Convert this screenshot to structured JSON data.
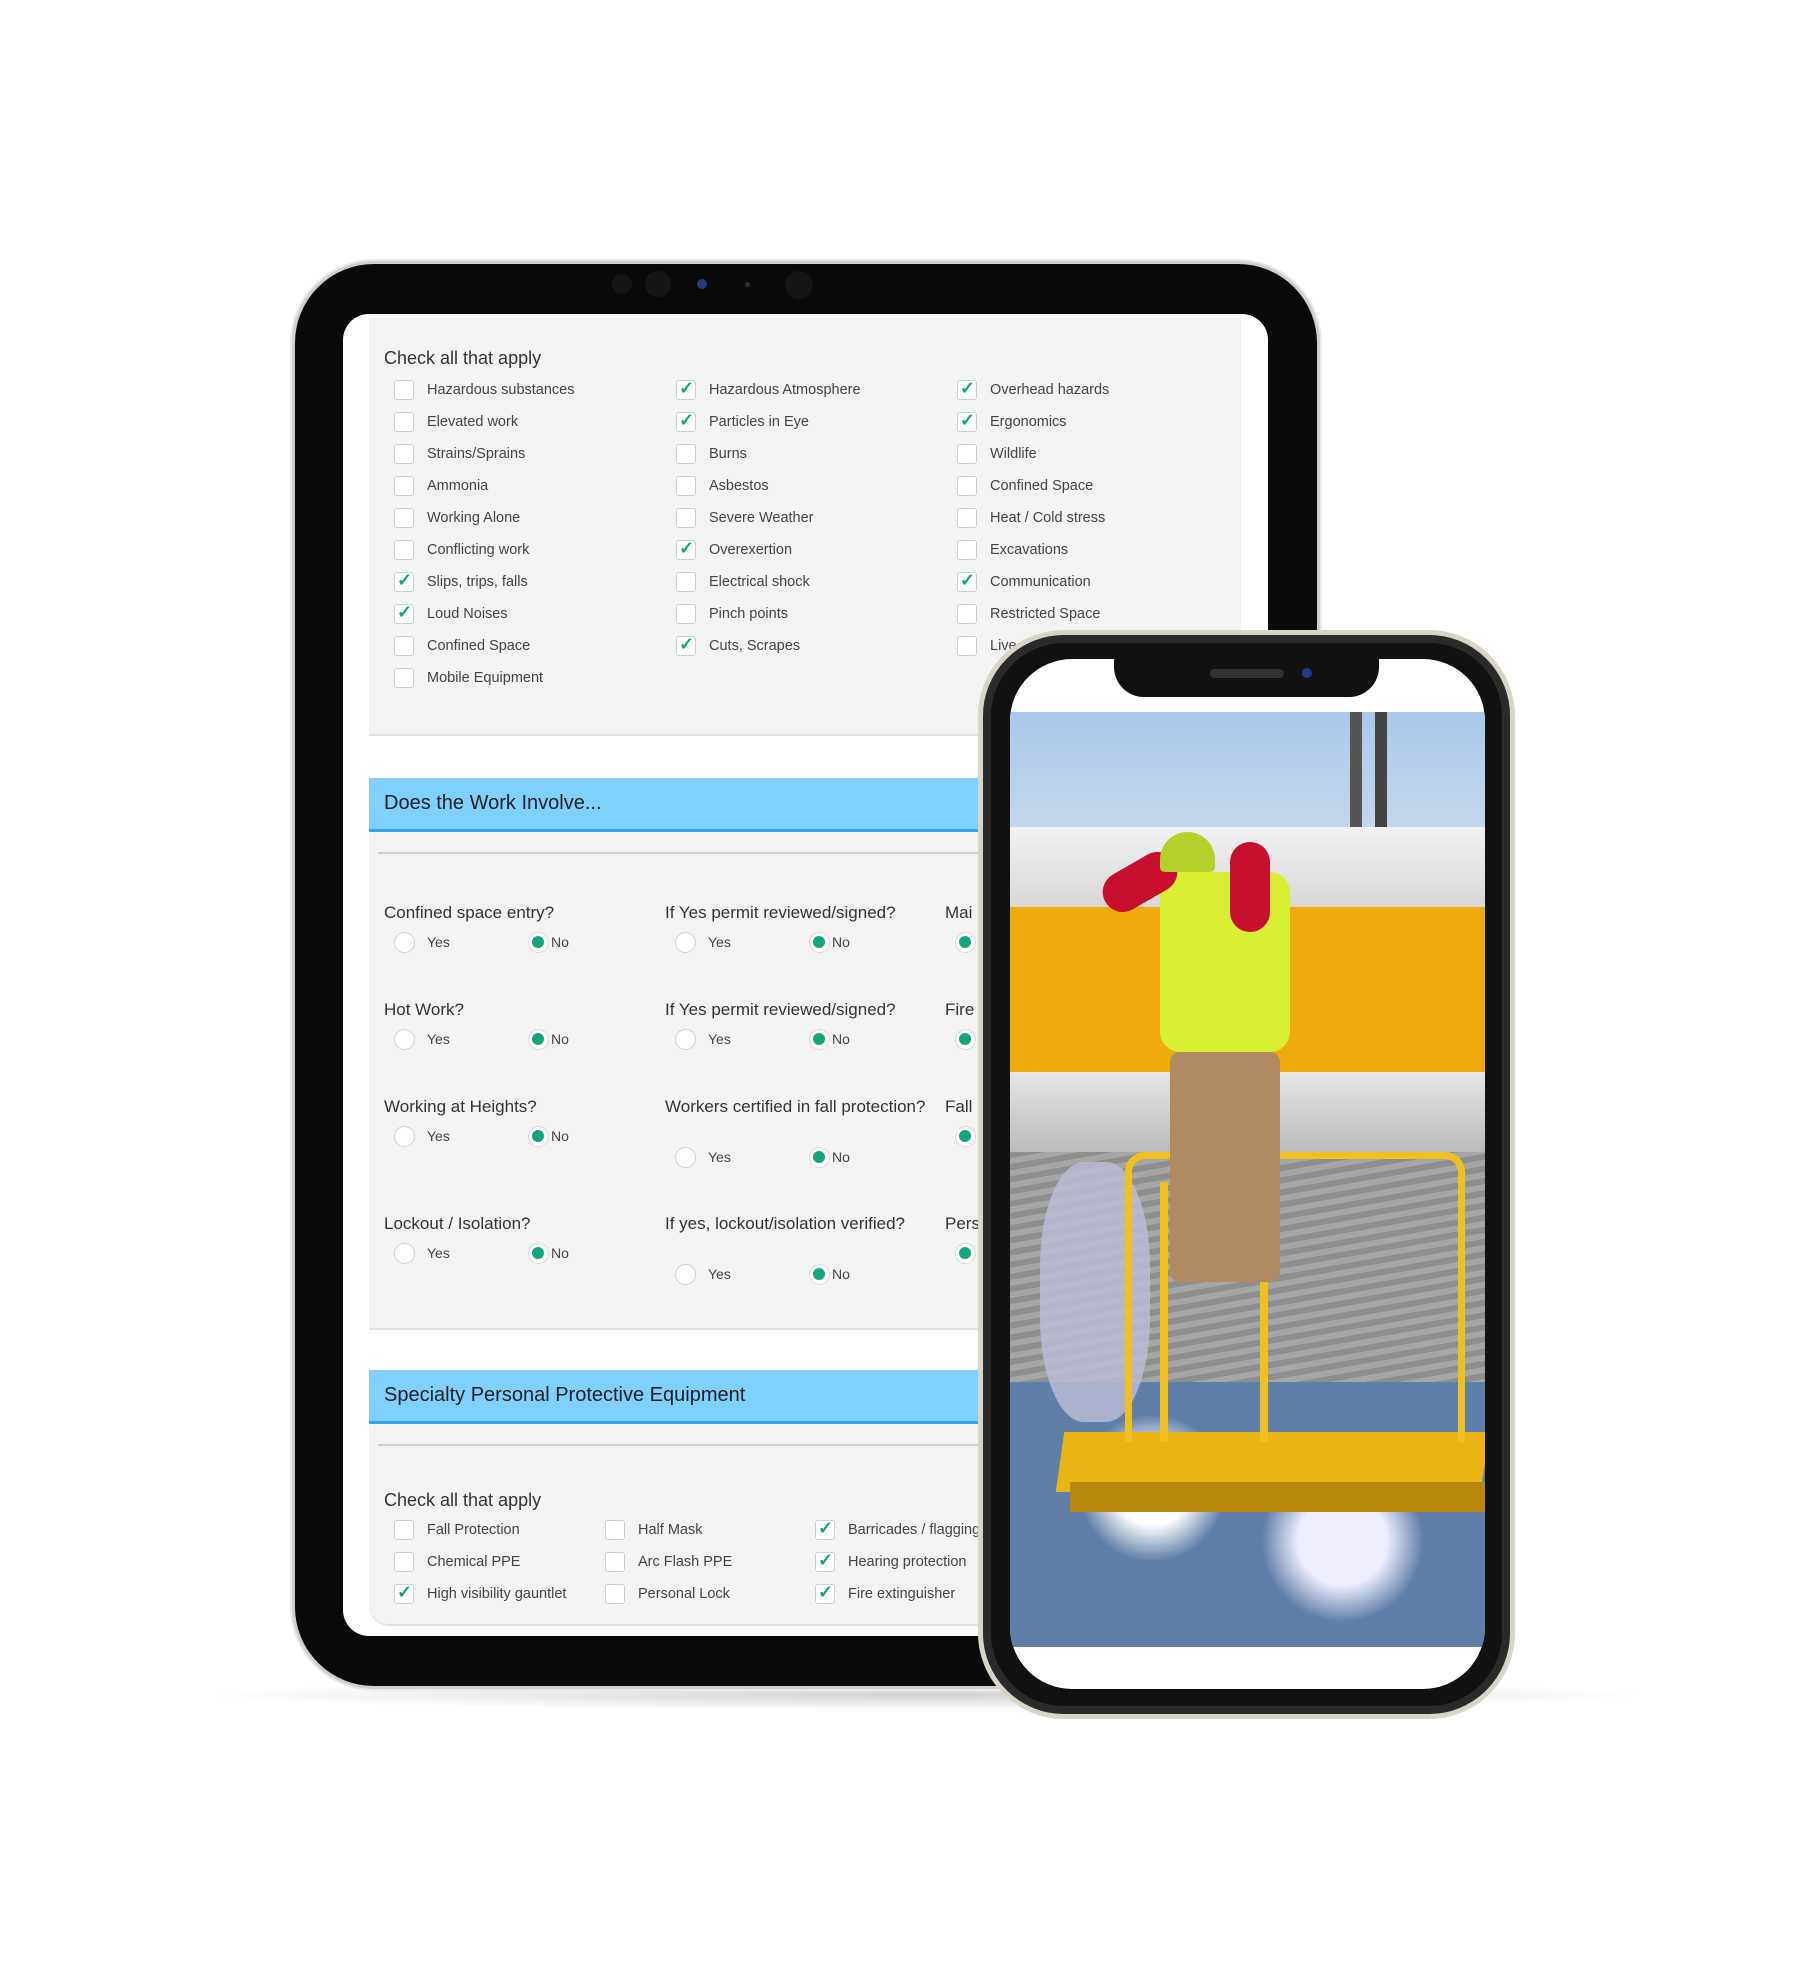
{
  "colors": {
    "accent_green": "#13a67e",
    "header_blue": "#7fcfff",
    "header_border": "#2fa7f0"
  },
  "hazards": {
    "heading": "Check all that apply",
    "columns": [
      [
        {
          "label": "Hazardous substances",
          "checked": false
        },
        {
          "label": "Elevated work",
          "checked": false
        },
        {
          "label": "Strains/Sprains",
          "checked": false
        },
        {
          "label": "Ammonia",
          "checked": false
        },
        {
          "label": "Working Alone",
          "checked": false
        },
        {
          "label": "Conflicting work",
          "checked": false
        },
        {
          "label": "Slips, trips, falls",
          "checked": true
        },
        {
          "label": "Loud Noises",
          "checked": true
        },
        {
          "label": "Confined Space",
          "checked": false
        },
        {
          "label": "Mobile Equipment",
          "checked": false
        }
      ],
      [
        {
          "label": "Hazardous Atmosphere",
          "checked": true
        },
        {
          "label": "Particles in Eye",
          "checked": true
        },
        {
          "label": "Burns",
          "checked": false
        },
        {
          "label": "Asbestos",
          "checked": false
        },
        {
          "label": "Severe Weather",
          "checked": false
        },
        {
          "label": "Overexertion",
          "checked": true
        },
        {
          "label": "Electrical shock",
          "checked": false
        },
        {
          "label": "Pinch points",
          "checked": false
        },
        {
          "label": "Cuts, Scrapes",
          "checked": true
        }
      ],
      [
        {
          "label": "Overhead hazards",
          "checked": true
        },
        {
          "label": "Ergonomics",
          "checked": true
        },
        {
          "label": "Wildlife",
          "checked": false
        },
        {
          "label": "Confined Space",
          "checked": false
        },
        {
          "label": "Heat / Cold stress",
          "checked": false
        },
        {
          "label": "Excavations",
          "checked": false
        },
        {
          "label": "Communication",
          "checked": true
        },
        {
          "label": "Restricted Space",
          "checked": false
        },
        {
          "label": "Live O",
          "checked": false
        }
      ]
    ]
  },
  "work_involve": {
    "title": "Does the Work Involve...",
    "yes_label": "Yes",
    "no_label": "No",
    "columns": [
      [
        {
          "q": "Confined space entry?",
          "answer": "No"
        },
        {
          "q": "Hot Work?",
          "answer": "No"
        },
        {
          "q": "Working at Heights?",
          "answer": "No"
        },
        {
          "q": "Lockout / Isolation?",
          "answer": "No"
        }
      ],
      [
        {
          "q": "If Yes permit reviewed/signed?",
          "answer": "No"
        },
        {
          "q": "If Yes permit reviewed/signed?",
          "answer": "No"
        },
        {
          "q": "Workers certified in fall protection?",
          "answer": "No"
        },
        {
          "q": "If yes, lockout/isolation verified?",
          "answer": "No"
        }
      ],
      [
        {
          "q": "Mai",
          "answer": "Yes"
        },
        {
          "q": "Fire",
          "answer": "Yes"
        },
        {
          "q": "Fall",
          "answer": "Yes"
        },
        {
          "q": "Pers",
          "answer": "Yes"
        }
      ]
    ]
  },
  "ppe": {
    "title": "Specialty Personal Protective Equipment",
    "heading": "Check all that apply",
    "columns": [
      [
        {
          "label": "Fall Protection",
          "checked": false
        },
        {
          "label": "Chemical PPE",
          "checked": false
        },
        {
          "label": "High visibility gauntlet",
          "checked": true
        }
      ],
      [
        {
          "label": "Half Mask",
          "checked": false
        },
        {
          "label": "Arc Flash PPE",
          "checked": false
        },
        {
          "label": "Personal Lock",
          "checked": false
        }
      ],
      [
        {
          "label": "Barricades / flagging",
          "checked": true
        },
        {
          "label": "Hearing protection",
          "checked": true
        },
        {
          "label": "Fire extinguisher",
          "checked": true
        }
      ]
    ]
  }
}
